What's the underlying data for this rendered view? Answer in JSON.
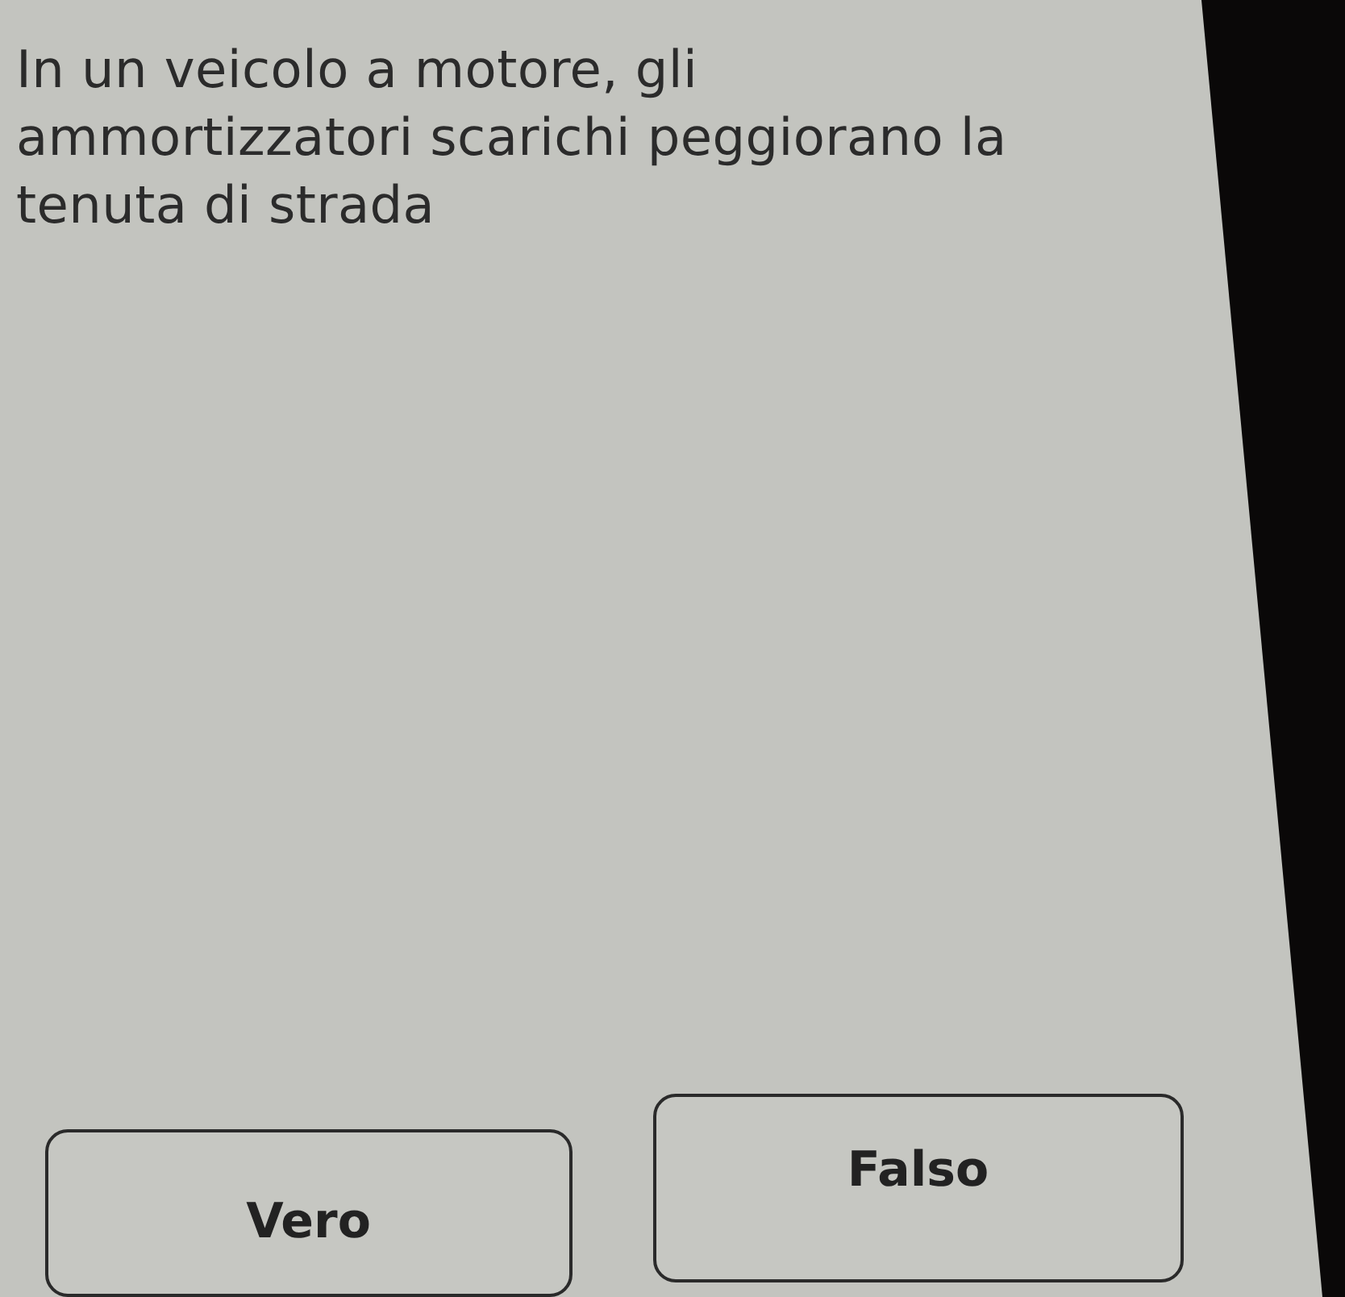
{
  "question": "In un veicolo a motore, gli ammortizzatori scarichi peggiorano la tenuta di strada",
  "answers": [
    {
      "label": "Vero"
    },
    {
      "label": "Falso"
    }
  ]
}
